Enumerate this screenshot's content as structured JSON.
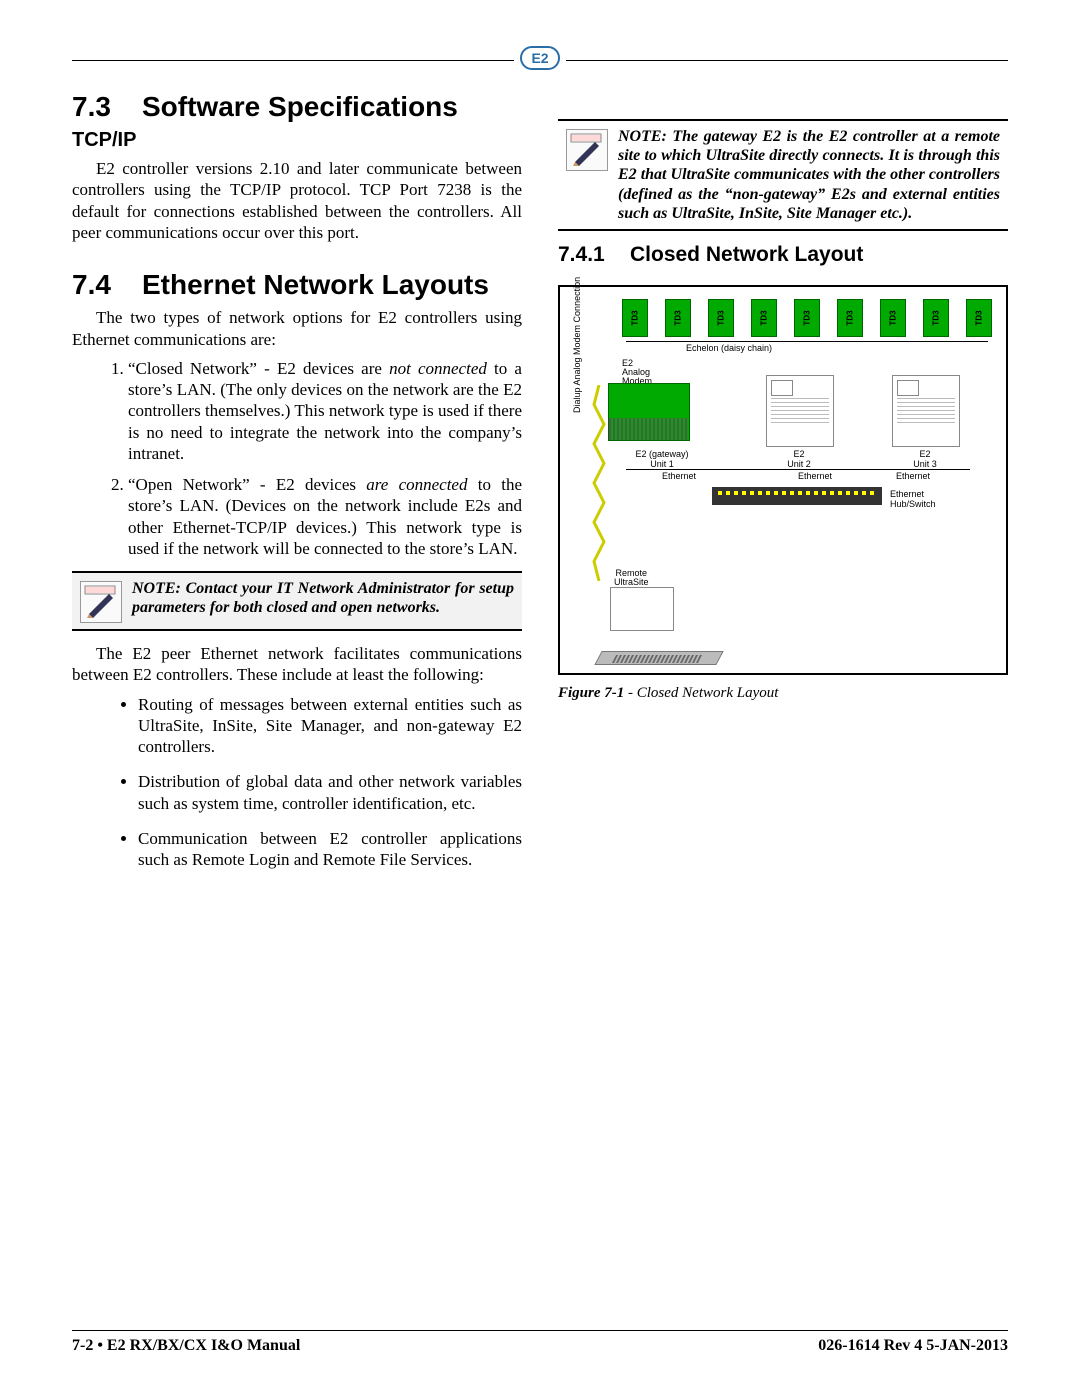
{
  "header": {
    "logo_text": "E2"
  },
  "section73": {
    "num": "7.3",
    "title": "Software Specifications",
    "tcpip_heading": "TCP/IP",
    "tcpip_body": "E2 controller versions 2.10 and later communicate between controllers using the TCP/IP protocol. TCP Port 7238 is the default for connections established between the controllers. All peer communications occur over this port."
  },
  "section74": {
    "num": "7.4",
    "title": "Ethernet Network Layouts",
    "intro": "The two types of network options for E2 controllers using Ethernet communications are:",
    "list": [
      {
        "lead": "“Closed Network” - E2 devices are ",
        "em": "not connected",
        "tail": " to a store’s LAN. (The only devices on the network are the E2 controllers themselves.) This network type is used if there is no need to integrate the network into the company’s intranet."
      },
      {
        "lead": "“Open Network” - E2 devices ",
        "em": "are connected",
        "tail": " to the store’s LAN. (Devices on the network include E2s and other Ethernet-TCP/IP devices.) This network type is used if the network will be connected to the store’s LAN."
      }
    ],
    "note1": "NOTE: Contact your IT Network Administrator for setup parameters for both closed and open networks.",
    "para2": "The E2 peer Ethernet network facilitates communications between E2 controllers. These include at least the following:",
    "bullets": [
      "Routing of messages between external entities such as UltraSite, InSite, Site Manager, and non-gateway E2 controllers.",
      "Distribution of global data and other network variables such as system time, controller identification, etc.",
      "Communication between E2 controller applications such as Remote Login and Remote File Services."
    ]
  },
  "right": {
    "note2": "NOTE: The gateway E2 is the E2 controller at a remote site to which UltraSite directly connects. It is through this E2 that UltraSite communicates with the other controllers (defined as the “non-gateway” E2s and external entities such as UltraSite, InSite, Site Manager etc.).",
    "sub_num": "7.4.1",
    "sub_title": "Closed Network Layout",
    "figure": {
      "echelon_label": "Echelon (daisy chain)",
      "td3_label": "TD3",
      "e2_analog_modem": "E2\nAnalog\nModem",
      "unit1": "E2 (gateway)\nUnit 1",
      "unit2": "E2\nUnit 2",
      "unit3": "E2\nUnit 3",
      "ethernet": "Ethernet",
      "hub": "Ethernet\nHub/Switch",
      "modem_conn": "Dialup Analog Modem Connection",
      "remote": "Remote\nUltraSite",
      "caption_label": "Figure 7-1",
      "caption_title": " - Closed Network Layout"
    }
  },
  "footer": {
    "left": "7-2 • E2 RX/BX/CX I&O Manual",
    "right": "026-1614 Rev 4 5-JAN-2013"
  }
}
